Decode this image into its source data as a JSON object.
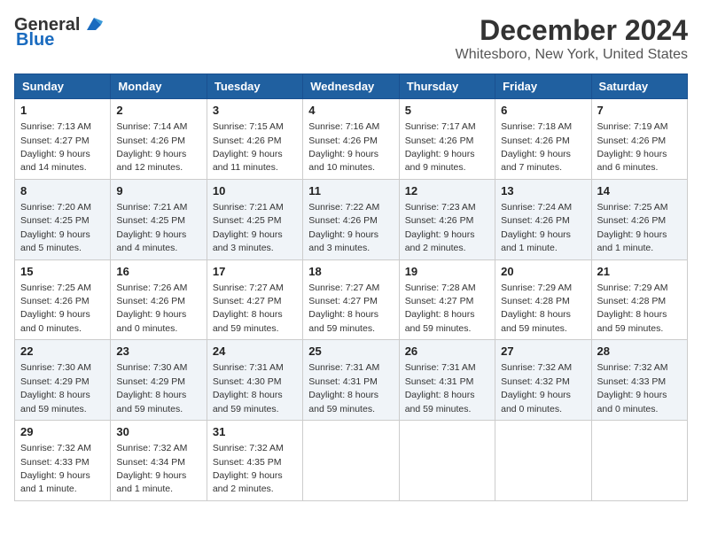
{
  "logo": {
    "general": "General",
    "blue": "Blue"
  },
  "title": "December 2024",
  "location": "Whitesboro, New York, United States",
  "days_of_week": [
    "Sunday",
    "Monday",
    "Tuesday",
    "Wednesday",
    "Thursday",
    "Friday",
    "Saturday"
  ],
  "weeks": [
    [
      {
        "day": "1",
        "sunrise": "Sunrise: 7:13 AM",
        "sunset": "Sunset: 4:27 PM",
        "daylight": "Daylight: 9 hours and 14 minutes."
      },
      {
        "day": "2",
        "sunrise": "Sunrise: 7:14 AM",
        "sunset": "Sunset: 4:26 PM",
        "daylight": "Daylight: 9 hours and 12 minutes."
      },
      {
        "day": "3",
        "sunrise": "Sunrise: 7:15 AM",
        "sunset": "Sunset: 4:26 PM",
        "daylight": "Daylight: 9 hours and 11 minutes."
      },
      {
        "day": "4",
        "sunrise": "Sunrise: 7:16 AM",
        "sunset": "Sunset: 4:26 PM",
        "daylight": "Daylight: 9 hours and 10 minutes."
      },
      {
        "day": "5",
        "sunrise": "Sunrise: 7:17 AM",
        "sunset": "Sunset: 4:26 PM",
        "daylight": "Daylight: 9 hours and 9 minutes."
      },
      {
        "day": "6",
        "sunrise": "Sunrise: 7:18 AM",
        "sunset": "Sunset: 4:26 PM",
        "daylight": "Daylight: 9 hours and 7 minutes."
      },
      {
        "day": "7",
        "sunrise": "Sunrise: 7:19 AM",
        "sunset": "Sunset: 4:26 PM",
        "daylight": "Daylight: 9 hours and 6 minutes."
      }
    ],
    [
      {
        "day": "8",
        "sunrise": "Sunrise: 7:20 AM",
        "sunset": "Sunset: 4:25 PM",
        "daylight": "Daylight: 9 hours and 5 minutes."
      },
      {
        "day": "9",
        "sunrise": "Sunrise: 7:21 AM",
        "sunset": "Sunset: 4:25 PM",
        "daylight": "Daylight: 9 hours and 4 minutes."
      },
      {
        "day": "10",
        "sunrise": "Sunrise: 7:21 AM",
        "sunset": "Sunset: 4:25 PM",
        "daylight": "Daylight: 9 hours and 3 minutes."
      },
      {
        "day": "11",
        "sunrise": "Sunrise: 7:22 AM",
        "sunset": "Sunset: 4:26 PM",
        "daylight": "Daylight: 9 hours and 3 minutes."
      },
      {
        "day": "12",
        "sunrise": "Sunrise: 7:23 AM",
        "sunset": "Sunset: 4:26 PM",
        "daylight": "Daylight: 9 hours and 2 minutes."
      },
      {
        "day": "13",
        "sunrise": "Sunrise: 7:24 AM",
        "sunset": "Sunset: 4:26 PM",
        "daylight": "Daylight: 9 hours and 1 minute."
      },
      {
        "day": "14",
        "sunrise": "Sunrise: 7:25 AM",
        "sunset": "Sunset: 4:26 PM",
        "daylight": "Daylight: 9 hours and 1 minute."
      }
    ],
    [
      {
        "day": "15",
        "sunrise": "Sunrise: 7:25 AM",
        "sunset": "Sunset: 4:26 PM",
        "daylight": "Daylight: 9 hours and 0 minutes."
      },
      {
        "day": "16",
        "sunrise": "Sunrise: 7:26 AM",
        "sunset": "Sunset: 4:26 PM",
        "daylight": "Daylight: 9 hours and 0 minutes."
      },
      {
        "day": "17",
        "sunrise": "Sunrise: 7:27 AM",
        "sunset": "Sunset: 4:27 PM",
        "daylight": "Daylight: 8 hours and 59 minutes."
      },
      {
        "day": "18",
        "sunrise": "Sunrise: 7:27 AM",
        "sunset": "Sunset: 4:27 PM",
        "daylight": "Daylight: 8 hours and 59 minutes."
      },
      {
        "day": "19",
        "sunrise": "Sunrise: 7:28 AM",
        "sunset": "Sunset: 4:27 PM",
        "daylight": "Daylight: 8 hours and 59 minutes."
      },
      {
        "day": "20",
        "sunrise": "Sunrise: 7:29 AM",
        "sunset": "Sunset: 4:28 PM",
        "daylight": "Daylight: 8 hours and 59 minutes."
      },
      {
        "day": "21",
        "sunrise": "Sunrise: 7:29 AM",
        "sunset": "Sunset: 4:28 PM",
        "daylight": "Daylight: 8 hours and 59 minutes."
      }
    ],
    [
      {
        "day": "22",
        "sunrise": "Sunrise: 7:30 AM",
        "sunset": "Sunset: 4:29 PM",
        "daylight": "Daylight: 8 hours and 59 minutes."
      },
      {
        "day": "23",
        "sunrise": "Sunrise: 7:30 AM",
        "sunset": "Sunset: 4:29 PM",
        "daylight": "Daylight: 8 hours and 59 minutes."
      },
      {
        "day": "24",
        "sunrise": "Sunrise: 7:31 AM",
        "sunset": "Sunset: 4:30 PM",
        "daylight": "Daylight: 8 hours and 59 minutes."
      },
      {
        "day": "25",
        "sunrise": "Sunrise: 7:31 AM",
        "sunset": "Sunset: 4:31 PM",
        "daylight": "Daylight: 8 hours and 59 minutes."
      },
      {
        "day": "26",
        "sunrise": "Sunrise: 7:31 AM",
        "sunset": "Sunset: 4:31 PM",
        "daylight": "Daylight: 8 hours and 59 minutes."
      },
      {
        "day": "27",
        "sunrise": "Sunrise: 7:32 AM",
        "sunset": "Sunset: 4:32 PM",
        "daylight": "Daylight: 9 hours and 0 minutes."
      },
      {
        "day": "28",
        "sunrise": "Sunrise: 7:32 AM",
        "sunset": "Sunset: 4:33 PM",
        "daylight": "Daylight: 9 hours and 0 minutes."
      }
    ],
    [
      {
        "day": "29",
        "sunrise": "Sunrise: 7:32 AM",
        "sunset": "Sunset: 4:33 PM",
        "daylight": "Daylight: 9 hours and 1 minute."
      },
      {
        "day": "30",
        "sunrise": "Sunrise: 7:32 AM",
        "sunset": "Sunset: 4:34 PM",
        "daylight": "Daylight: 9 hours and 1 minute."
      },
      {
        "day": "31",
        "sunrise": "Sunrise: 7:32 AM",
        "sunset": "Sunset: 4:35 PM",
        "daylight": "Daylight: 9 hours and 2 minutes."
      },
      null,
      null,
      null,
      null
    ]
  ]
}
